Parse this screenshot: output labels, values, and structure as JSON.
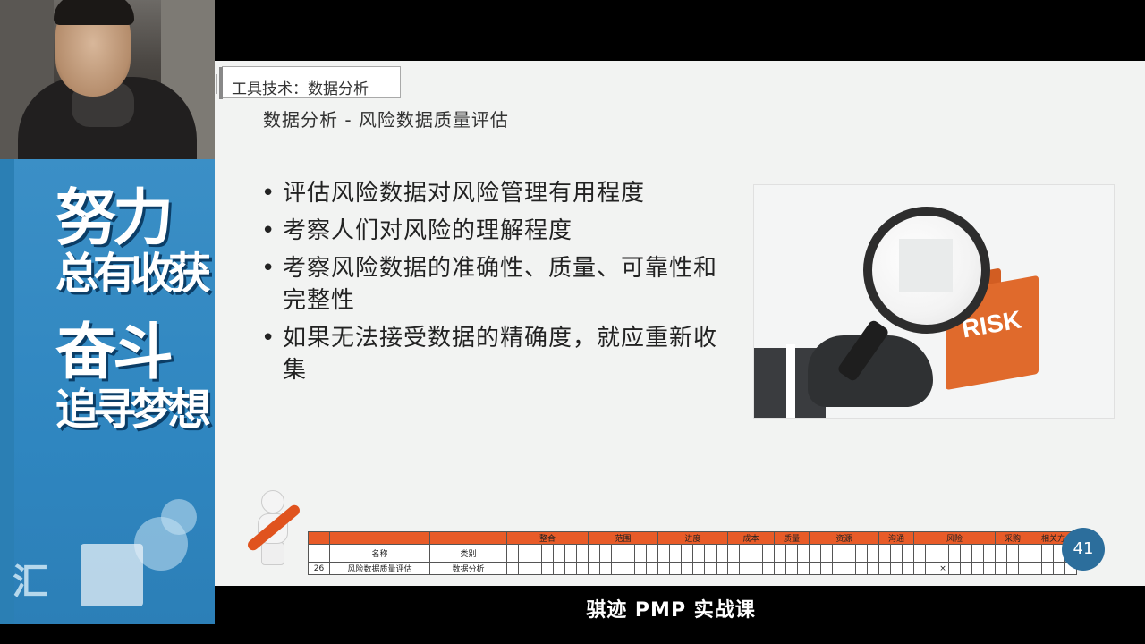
{
  "slide": {
    "tab_title": "工具技术：数据分析",
    "subtitle": "数据分析 - 风险数据质量评估",
    "bullets": [
      "评估风险数据对风险管理有用程度",
      "考察人们对风险的理解程度",
      "考察风险数据的准确性、质量、可靠性和完整性",
      "如果无法接受数据的精确度，就应重新收集"
    ],
    "image_text": "RISK",
    "page_number": "41"
  },
  "banner": {
    "line1": "努力",
    "line2": "总有收获",
    "line3": "奋斗",
    "line4": "追寻梦想",
    "corner_letter": "汇"
  },
  "table": {
    "group_headers": [
      "整合",
      "范围",
      "进度",
      "成本",
      "质量",
      "资源",
      "沟通",
      "风险",
      "采购",
      "相关方"
    ],
    "col_name": "名称",
    "col_type": "类别",
    "row": {
      "index": "26",
      "name": "风险数据质量评估",
      "type": "数据分析",
      "mark": "×"
    }
  },
  "caption": "骐迹 PMP 实战课",
  "colors": {
    "banner_blue": "#2f86c0",
    "table_header_orange": "#e85b28",
    "page_badge": "#2c6e9c",
    "folder_orange": "#e06a2c"
  }
}
